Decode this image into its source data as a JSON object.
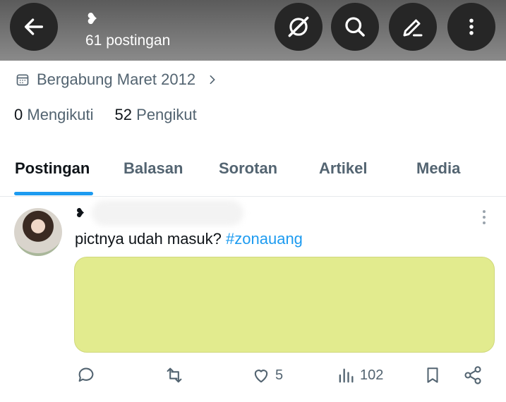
{
  "header": {
    "profile_glyph": "❥",
    "post_count": "61 postingan",
    "icons": [
      "back-arrow-icon",
      "grok-icon",
      "search-icon",
      "edit-icon",
      "more-vertical-icon"
    ]
  },
  "profile": {
    "joined": "Bergabung Maret 2012",
    "following_count": "0",
    "following_label": "Mengikuti",
    "followers_count": "52",
    "followers_label": "Pengikut"
  },
  "tabs": [
    "Postingan",
    "Balasan",
    "Sorotan",
    "Artikel",
    "Media"
  ],
  "active_tab": "Postingan",
  "post": {
    "author_glyph": "❥",
    "text": "pictnya udah masuk? ",
    "hashtag": "#zonauang",
    "media_color": "#e2eb8e",
    "actions": {
      "reply": "",
      "repost": "",
      "likes": "5",
      "views": "102"
    }
  },
  "colors": {
    "accent": "#1d9bf0",
    "header_bg": "#707070",
    "icon_gray": "#536471"
  }
}
